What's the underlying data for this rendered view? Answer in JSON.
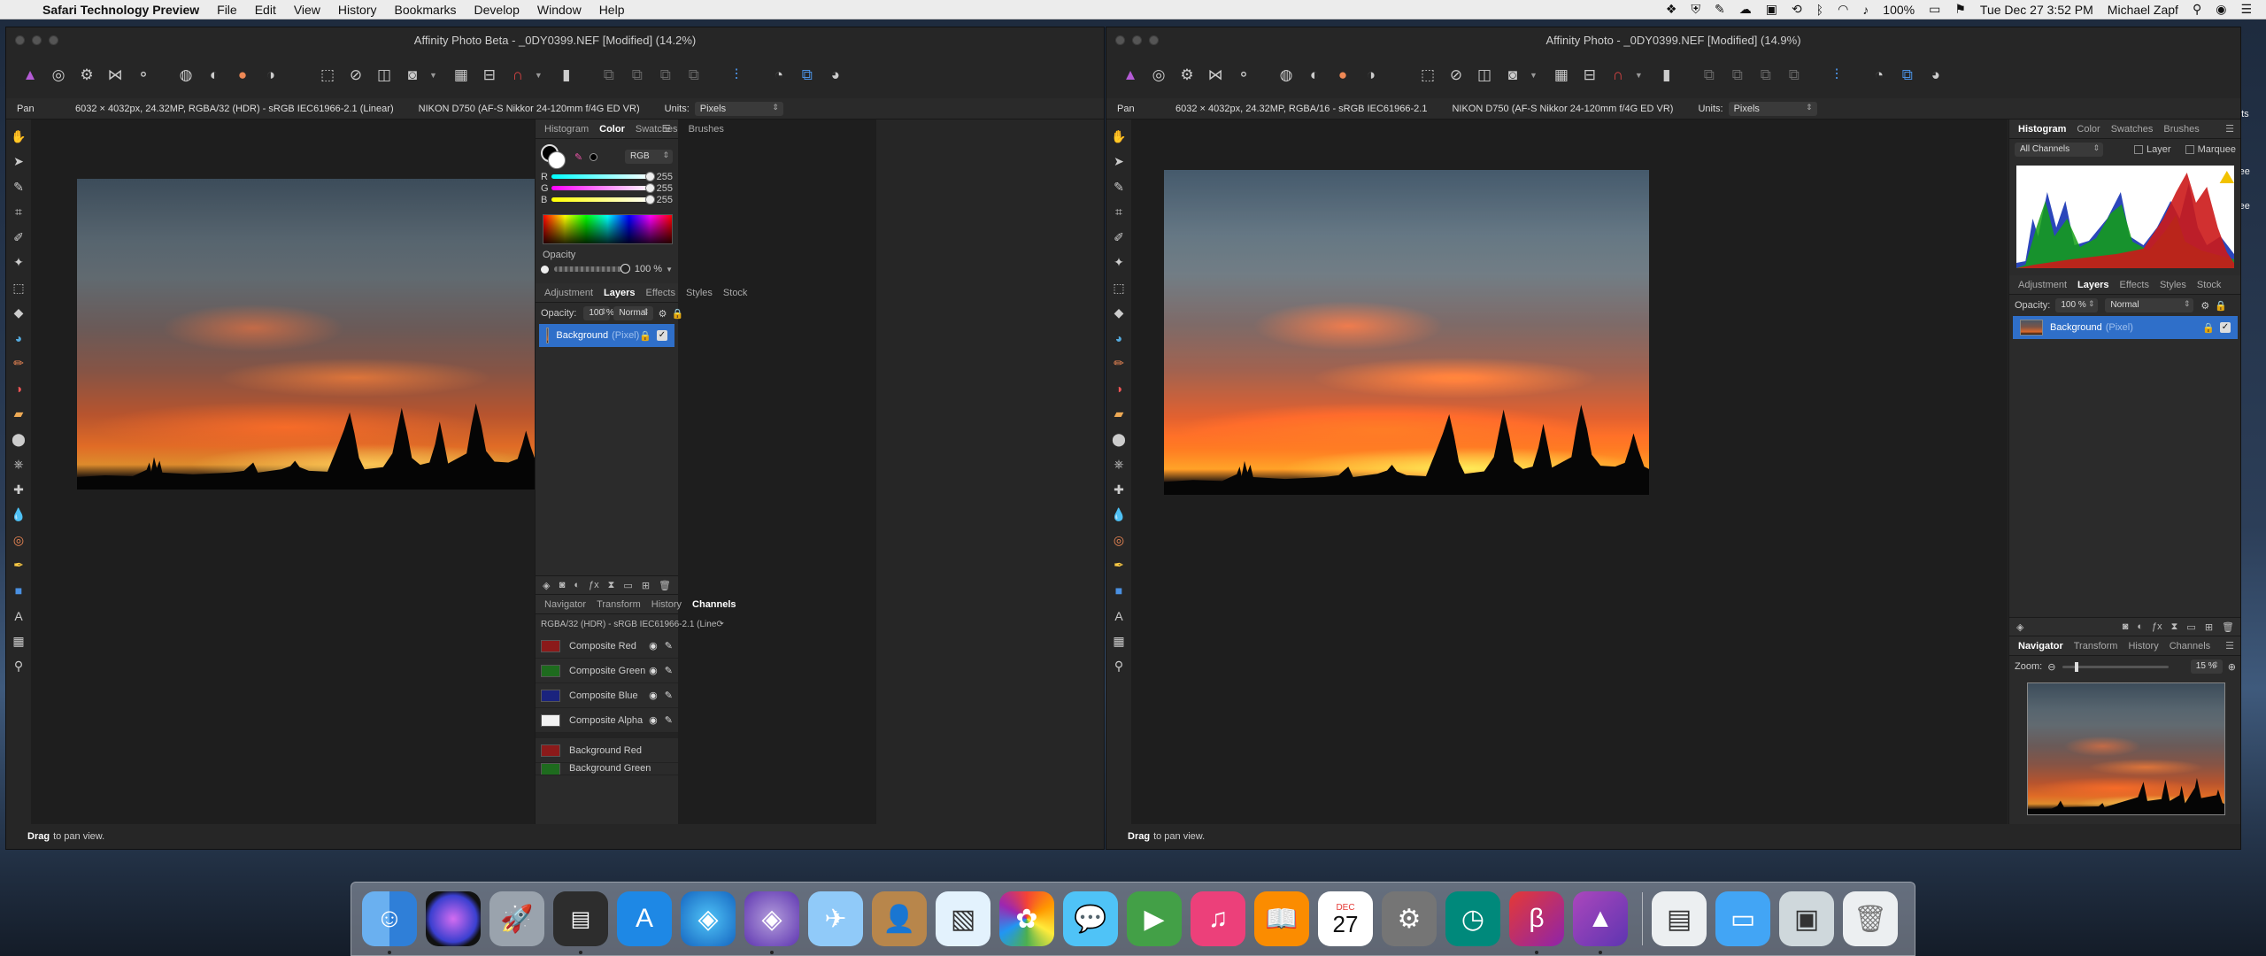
{
  "menubar": {
    "app": "Safari Technology Preview",
    "items": [
      "File",
      "Edit",
      "View",
      "History",
      "Bookmarks",
      "Develop",
      "Window",
      "Help"
    ],
    "battery": "100%",
    "clock": "Tue Dec 27  3:52 PM",
    "user": "Michael Zapf"
  },
  "left": {
    "title": "Affinity Photo Beta - _0DY0399.NEF [Modified] (14.2%)",
    "context": {
      "tool": "Pan",
      "image_info": "6032 × 4032px, 24.32MP, RGBA/32 (HDR) - sRGB IEC61966-2.1 (Linear)",
      "camera": "NIKON D750 (AF-S Nikkor 24-120mm f/4G ED VR)",
      "units_label": "Units:",
      "units_value": "Pixels"
    },
    "top_tabs": [
      "Histogram",
      "Color",
      "Swatches",
      "Brushes"
    ],
    "color": {
      "mode": "RGB",
      "channels": [
        {
          "label": "R",
          "value": "255"
        },
        {
          "label": "G",
          "value": "255"
        },
        {
          "label": "B",
          "value": "255"
        }
      ],
      "opacity_label": "Opacity",
      "opacity_value": "100 %"
    },
    "mid_tabs": [
      "Adjustment",
      "Layers",
      "Effects",
      "Styles",
      "Stock"
    ],
    "layers": {
      "opacity_label": "Opacity:",
      "opacity_value": "100 %",
      "blend": "Normal",
      "layer_name": "Background",
      "layer_type": "(Pixel)"
    },
    "bottom_tabs": [
      "Navigator",
      "Transform",
      "History",
      "Channels"
    ],
    "channels_header": "RGBA/32 (HDR) - sRGB IEC61966-2.1 (Line",
    "channels": [
      {
        "name": "Composite Red",
        "color": "#8b1a1a"
      },
      {
        "name": "Composite Green",
        "color": "#1e6b1e"
      },
      {
        "name": "Composite Blue",
        "color": "#1a237e"
      },
      {
        "name": "Composite Alpha",
        "color": "#f2f2f2"
      },
      {
        "name": "Background Red",
        "color": "#8b1a1a"
      },
      {
        "name": "Background Green",
        "color": "#1e6b1e"
      }
    ],
    "status_bold": "Drag",
    "status_text": "to pan view."
  },
  "right": {
    "title": "Affinity Photo - _0DY0399.NEF [Modified] (14.9%)",
    "context": {
      "tool": "Pan",
      "image_info": "6032 × 4032px, 24.32MP, RGBA/16 - sRGB IEC61966-2.1",
      "camera": "NIKON D750 (AF-S Nikkor 24-120mm f/4G ED VR)",
      "units_label": "Units:",
      "units_value": "Pixels"
    },
    "top_tabs": [
      "Histogram",
      "Color",
      "Swatches",
      "Brushes"
    ],
    "histogram": {
      "channel": "All Channels",
      "layer_label": "Layer",
      "marquee_label": "Marquee"
    },
    "mid_tabs": [
      "Adjustment",
      "Layers",
      "Effects",
      "Styles",
      "Stock"
    ],
    "layers": {
      "opacity_label": "Opacity:",
      "opacity_value": "100 %",
      "blend": "Normal",
      "layer_name": "Background",
      "layer_type": "(Pixel)"
    },
    "bottom_tabs": [
      "Navigator",
      "Transform",
      "History",
      "Channels"
    ],
    "navigator": {
      "zoom_label": "Zoom:",
      "zoom_value": "15 %"
    },
    "status_bold": "Drag",
    "status_text": "to pan view."
  },
  "dock": {
    "calendar_month": "DEC",
    "calendar_day": "27",
    "beta_label": "β"
  }
}
